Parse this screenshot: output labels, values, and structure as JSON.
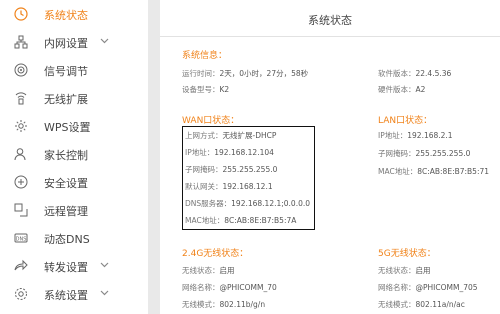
{
  "sidebar": {
    "items": [
      {
        "label": "系统状态",
        "icon": "clock-icon"
      },
      {
        "label": "内网设置",
        "icon": "network-icon"
      },
      {
        "label": "信号调节",
        "icon": "signal-icon"
      },
      {
        "label": "无线扩展",
        "icon": "wireless-extend-icon"
      },
      {
        "label": "WPS设置",
        "icon": "gear-icon"
      },
      {
        "label": "家长控制",
        "icon": "person-icon"
      },
      {
        "label": "安全设置",
        "icon": "shield-icon"
      },
      {
        "label": "远程管理",
        "icon": "remote-icon"
      },
      {
        "label": "动态DNS",
        "icon": "dns-icon"
      },
      {
        "label": "转发设置",
        "icon": "forward-icon"
      },
      {
        "label": "系统设置",
        "icon": "settings-icon"
      }
    ]
  },
  "header": {
    "title": "系统状态"
  },
  "system_info": {
    "title": "系统信息：",
    "uptime_label": "运行时间：",
    "uptime_value": "2天，0小时，27分，58秒",
    "model_label": "设备型号：",
    "model_value": "K2",
    "software_label": "软件版本：",
    "software_value": "22.4.5.36",
    "hardware_label": "硬件版本：",
    "hardware_value": "A2"
  },
  "wan": {
    "title": "WAN口状态：",
    "access_label": "上网方式：",
    "access_value": "无线扩展-DHCP",
    "ip_label": "IP地址：",
    "ip_value": "192.168.12.104",
    "mask_label": "子网掩码：",
    "mask_value": "255.255.255.0",
    "gateway_label": "默认网关：",
    "gateway_value": "192.168.12.1",
    "dns_label": "DNS服务器：",
    "dns_value": "192.168.12.1;0.0.0.0",
    "mac_label": "MAC地址：",
    "mac_value": "8C:AB:8E:B7:B5:7A"
  },
  "lan": {
    "title": "LAN口状态：",
    "ip_label": "IP地址：",
    "ip_value": "192.168.2.1",
    "mask_label": "子网掩码：",
    "mask_value": "255.255.255.0",
    "mac_label": "MAC地址：",
    "mac_value": "8C:AB:8E:B7:B5:71"
  },
  "wifi24": {
    "title": "2.4G无线状态：",
    "status_label": "无线状态：",
    "status_value": "启用",
    "ssid_label": "网络名称：",
    "ssid_value": "@PHICOMM_70",
    "mode_label": "无线模式：",
    "mode_value": "802.11b/g/n"
  },
  "wifi5": {
    "title": "5G无线状态：",
    "status_label": "无线状态：",
    "status_value": "启用",
    "ssid_label": "网络名称：",
    "ssid_value": "@PHICOMM_705",
    "mode_label": "无线模式：",
    "mode_value": "802.11a/n/ac"
  },
  "colors": {
    "accent": "#f08219",
    "highlight_box": "#111111"
  }
}
